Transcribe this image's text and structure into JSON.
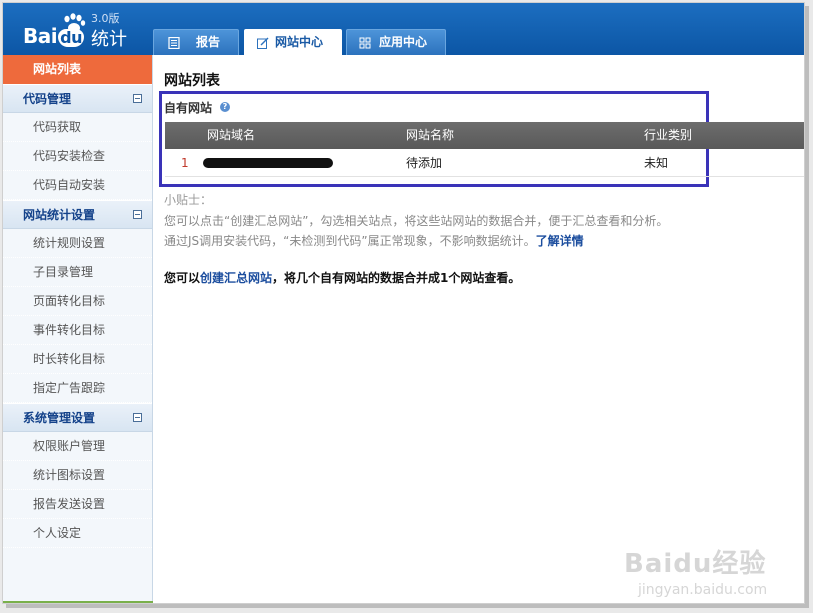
{
  "header": {
    "logo_brand": "Bai",
    "logo_du": "du",
    "logo_product": "统计",
    "logo_version": "3.0版",
    "tabs": [
      {
        "label": "报告",
        "icon": "report-icon",
        "active": false
      },
      {
        "label": "网站中心",
        "icon": "edit-icon",
        "active": true
      },
      {
        "label": "应用中心",
        "icon": "grid-icon",
        "active": false
      }
    ]
  },
  "sidebar": {
    "active_item": "网站列表",
    "groups": [
      {
        "title": "代码管理",
        "items": [
          "代码获取",
          "代码安装检查",
          "代码自动安装"
        ]
      },
      {
        "title": "网站统计设置",
        "items": [
          "统计规则设置",
          "子目录管理",
          "页面转化目标",
          "事件转化目标",
          "时长转化目标",
          "指定广告跟踪"
        ]
      },
      {
        "title": "系统管理设置",
        "items": [
          "权限账户管理",
          "统计图标设置",
          "报告发送设置",
          "个人设定"
        ]
      }
    ]
  },
  "main": {
    "title": "网站列表",
    "own_sites_label": "自有网站",
    "help_glyph": "?",
    "table": {
      "columns": [
        "网站域名",
        "网站名称",
        "行业类别"
      ],
      "rows": [
        {
          "index": "1",
          "domain": "",
          "name": "待添加",
          "industry": "未知"
        }
      ]
    },
    "tips": {
      "title": "小贴士：",
      "line1": "您可以点击“创建汇总网站”，勾选相关站点，将这些站网站的数据合并，便于汇总查看和分析。",
      "line2_prefix": "通过JS调用安装代码，“未检测到代码”属正常现象，不影响数据统计。",
      "line2_link": "了解详情"
    },
    "note": {
      "prefix": "您可以",
      "link": "创建汇总网站",
      "suffix": "，将几个自有网站的数据合并成1个网站查看。"
    }
  },
  "watermark": {
    "main": "Baidu经验",
    "sub": "jingyan.baidu.com"
  },
  "colors": {
    "header_blue": "#0c56a5",
    "active_orange": "#ee6a3c",
    "highlight_box": "#3a33b8",
    "table_header": "#595959"
  }
}
